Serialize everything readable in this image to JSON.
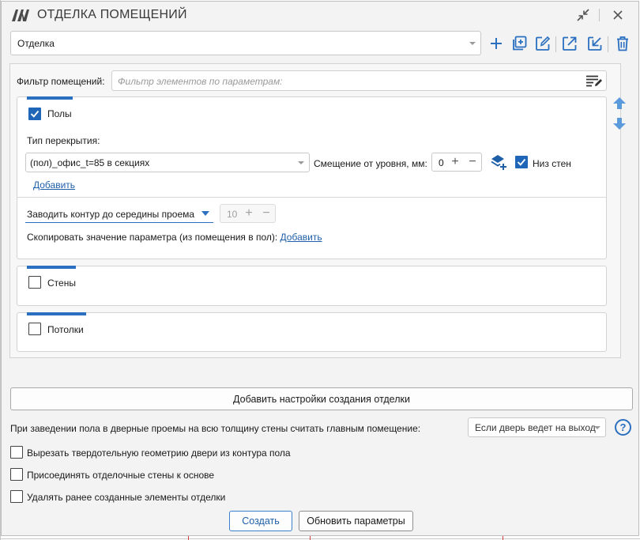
{
  "window": {
    "title": "ОТДЕЛКА ПОМЕЩЕНИЙ"
  },
  "profile": {
    "selected": "Отделка"
  },
  "filter": {
    "label": "Фильтр помещений:",
    "placeholder": "Фильтр элементов по параметрам:"
  },
  "floors": {
    "label": "Полы",
    "checked": true,
    "type_label": "Тип перекрытия:",
    "type_value": "(пол)_офис_t=85 в секциях",
    "offset_label": "Смещение от уровня, мм:",
    "offset_value": "0",
    "bottom_walls_label": "Низ стен",
    "bottom_walls_checked": true,
    "add_link": "Добавить",
    "contour_option": "Заводить контур до середины проема",
    "contour_value": "10",
    "copy_param_label": "Скопировать значение параметра (из помещения в пол):",
    "copy_param_link": "Добавить"
  },
  "walls": {
    "label": "Стены",
    "checked": false
  },
  "ceilings": {
    "label": "Потолки",
    "checked": false
  },
  "add_settings_button": "Добавить настройки создания отделки",
  "door_rule": {
    "label": "При заведении пола в дверные проемы на всю толщину стены считать главным помещение:",
    "value": "Если дверь ведет на выход"
  },
  "options": [
    {
      "label": "Вырезать твердотельную геометрию двери из контура пола",
      "checked": false
    },
    {
      "label": "Присоединять отделочные стены к основе",
      "checked": false
    },
    {
      "label": "Удалять ранее созданные элементы отделки",
      "checked": false
    }
  ],
  "actions": {
    "create": "Создать",
    "update": "Обновить параметры"
  },
  "colors": {
    "accent": "#2a6fc0",
    "checkbox_on": "#1f66b8",
    "link": "#1f5fa8"
  }
}
